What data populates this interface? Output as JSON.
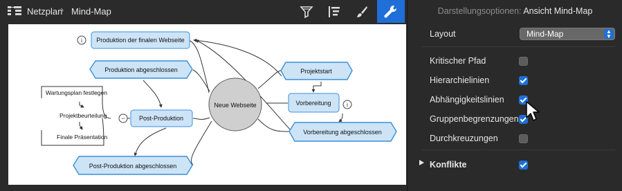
{
  "breadcrumb": {
    "parent": "Netzplan",
    "current": "Mind-Map"
  },
  "toolbar": {
    "tools": [
      {
        "name": "filter-icon"
      },
      {
        "name": "outline-view-icon"
      },
      {
        "name": "paintbrush-icon"
      },
      {
        "name": "wrench-icon",
        "active": true
      }
    ]
  },
  "mindmap": {
    "center": "Neue Webseite",
    "nodes": {
      "prod_final": "Produktion der finalen Webseite",
      "prod_done": "Produktion abgeschlossen",
      "post_prod": "Post-Produktion",
      "post_done": "Post-Produktion abgeschlossen",
      "projektstart": "Projektstart",
      "vorbereitung": "Vorbereitung",
      "vorb_done": "Vorbereitung abgeschlossen"
    },
    "subitems": {
      "wartung": "Wartungsplan festlegen",
      "beurteilung": "Projektbeurteilung",
      "praesentation": "Finale Präsentation"
    },
    "info_glyph": "i",
    "collapse_glyph": "−"
  },
  "panel": {
    "title_prefix": "Darstellungsoptionen:",
    "title_view": "Ansicht Mind-Map",
    "layout_label": "Layout",
    "layout_value": "Mind-Map",
    "options": [
      {
        "label": "Kritischer Pfad",
        "checked": false
      },
      {
        "label": "Hierarchielinien",
        "checked": true
      },
      {
        "label": "Abhängigkeitslinien",
        "checked": true
      },
      {
        "label": "Gruppenbegrenzungen",
        "checked": true
      },
      {
        "label": "Durchkreuzungen",
        "checked": false
      }
    ],
    "conflicts_label": "Konflikte",
    "conflicts_checked": true
  },
  "colors": {
    "accent": "#1f6fd6",
    "node_fill": "#cde4f7",
    "node_stroke": "#3a8fd8",
    "center_fill": "#cfcfcf"
  }
}
